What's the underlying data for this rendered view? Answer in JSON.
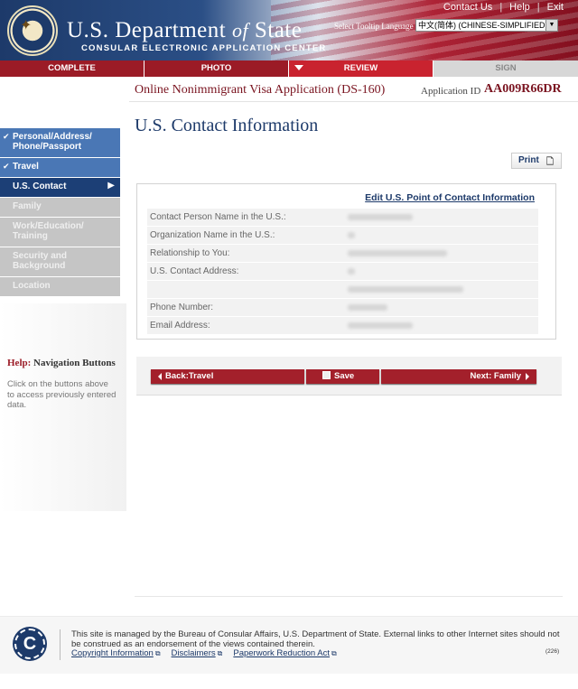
{
  "header": {
    "dept_prefix": "U.S. Department ",
    "dept_of": "of",
    "dept_suffix": " State",
    "subtitle": "CONSULAR ELECTRONIC APPLICATION CENTER",
    "links": [
      "Contact Us",
      "Help",
      "Exit"
    ],
    "tooltip_language_label": "Select Tooltip Language",
    "tooltip_language_value": "中文(简体) (CHINESE-SIMPLIFIED)"
  },
  "progress": {
    "steps": [
      {
        "label": "COMPLETE",
        "state": "done"
      },
      {
        "label": "PHOTO",
        "state": "done"
      },
      {
        "label": "REVIEW",
        "state": "current"
      },
      {
        "label": "SIGN",
        "state": "todo"
      }
    ]
  },
  "application": {
    "title": "Online Nonimmigrant Visa Application (DS-160)",
    "id_label": "Application ID",
    "id": "AA009R66DR"
  },
  "sidebar": {
    "items": [
      {
        "label": "Personal/Address/ Phone/Passport",
        "state": "visited"
      },
      {
        "label": "Travel",
        "state": "visited"
      },
      {
        "label": "U.S. Contact",
        "state": "active"
      },
      {
        "label": "Family",
        "state": "disabled"
      },
      {
        "label": "Work/Education/ Training",
        "state": "disabled"
      },
      {
        "label": "Security and Background",
        "state": "disabled"
      },
      {
        "label": "Location",
        "state": "disabled"
      }
    ]
  },
  "help": {
    "title_prefix": "Help:",
    "title": " Navigation Buttons",
    "text": "Click on the buttons above to access previously entered data."
  },
  "main": {
    "page_title": "U.S. Contact Information",
    "print_label": "Print",
    "edit_link": "Edit U.S. Point of Contact Information",
    "fields": [
      {
        "label": "Contact Person Name in the U.S.:"
      },
      {
        "label": "Organization Name in the U.S.:"
      },
      {
        "label": "Relationship to You:"
      },
      {
        "label": "U.S. Contact Address:"
      },
      {
        "label": ""
      },
      {
        "label": "Phone Number:"
      },
      {
        "label": "Email Address:"
      }
    ]
  },
  "nav_buttons": {
    "back": "Back:Travel",
    "save": "Save",
    "next": "Next: Family"
  },
  "footer": {
    "text": "This site is managed by the Bureau of Consular Affairs, U.S. Department of State. External links to other Internet sites should not be construed as an endorsement of the views contained therein.",
    "links": [
      "Copyright Information",
      "Disclaimers",
      "Paperwork Reduction Act"
    ],
    "code": "(226)",
    "logo_letter": "C"
  },
  "colors": {
    "navy": "#1d3a6a",
    "maroon": "#9b1b26",
    "visited_blue": "#4a77b5",
    "active_blue": "#1c3f76",
    "disabled_gray": "#c5c5c5"
  }
}
